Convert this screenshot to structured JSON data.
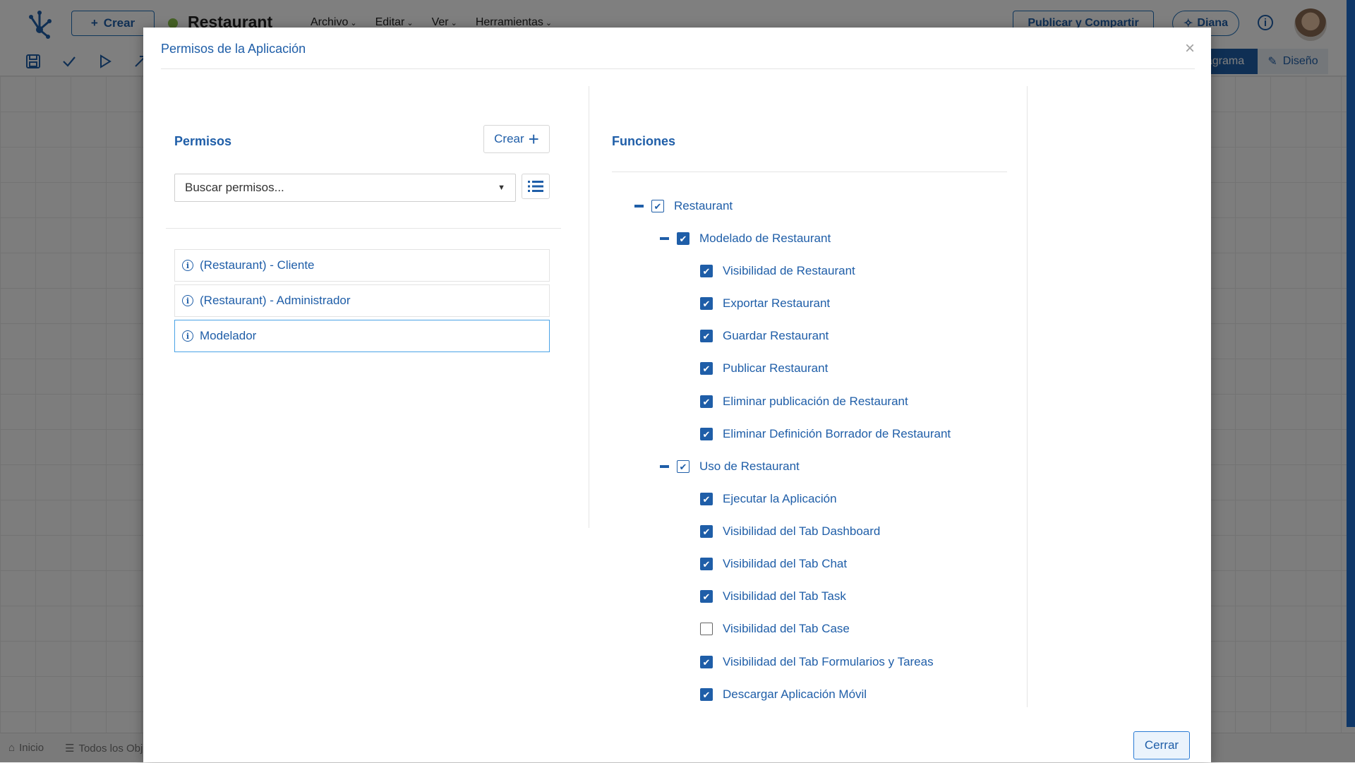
{
  "app": {
    "create_label": "Crear",
    "title": "Restaurant",
    "menu": [
      "Archivo",
      "Editar",
      "Ver",
      "Herramientas"
    ],
    "publish_label": "Publicar y Compartir",
    "assistant_label": "Diana",
    "tab_diagram_label": "agrama",
    "tab_design_label": "Diseño",
    "bottom_home": "Inicio",
    "bottom_all_objects": "Todos los Obj"
  },
  "modal": {
    "title": "Permisos de la Aplicación",
    "close_glyph": "×",
    "permissions_title": "Permisos",
    "create_button_label": "Crear",
    "search_placeholder": "Buscar permisos...",
    "permissions": [
      {
        "label": "(Restaurant) - Cliente",
        "selected": false
      },
      {
        "label": "(Restaurant) - Administrador",
        "selected": false
      },
      {
        "label": "Modelador",
        "selected": true
      }
    ],
    "functions_title": "Funciones",
    "tree": {
      "root": {
        "label": "Restaurant",
        "checked": true
      },
      "group1": {
        "label": "Modelado de Restaurant",
        "checked": true
      },
      "group1_items": [
        {
          "label": "Visibilidad de Restaurant",
          "checked": true
        },
        {
          "label": "Exportar Restaurant",
          "checked": true
        },
        {
          "label": "Guardar Restaurant",
          "checked": true
        },
        {
          "label": "Publicar Restaurant",
          "checked": true
        },
        {
          "label": "Eliminar publicación de Restaurant",
          "checked": true
        },
        {
          "label": "Eliminar Definición Borrador de Restaurant",
          "checked": true
        }
      ],
      "group2": {
        "label": "Uso de Restaurant",
        "checked": true
      },
      "group2_items": [
        {
          "label": "Ejecutar la Aplicación",
          "checked": true
        },
        {
          "label": "Visibilidad del Tab Dashboard",
          "checked": true
        },
        {
          "label": "Visibilidad del Tab Chat",
          "checked": true
        },
        {
          "label": "Visibilidad del Tab Task",
          "checked": true
        },
        {
          "label": "Visibilidad del Tab Case",
          "checked": false
        },
        {
          "label": "Visibilidad del Tab Formularios y Tareas",
          "checked": true
        },
        {
          "label": "Descargar Aplicación Móvil",
          "checked": true
        }
      ]
    },
    "close_button_label": "Cerrar"
  },
  "colors": {
    "accent": "#1f5ea8",
    "selected_border": "#4aa3e6",
    "overlay": "#000000"
  }
}
